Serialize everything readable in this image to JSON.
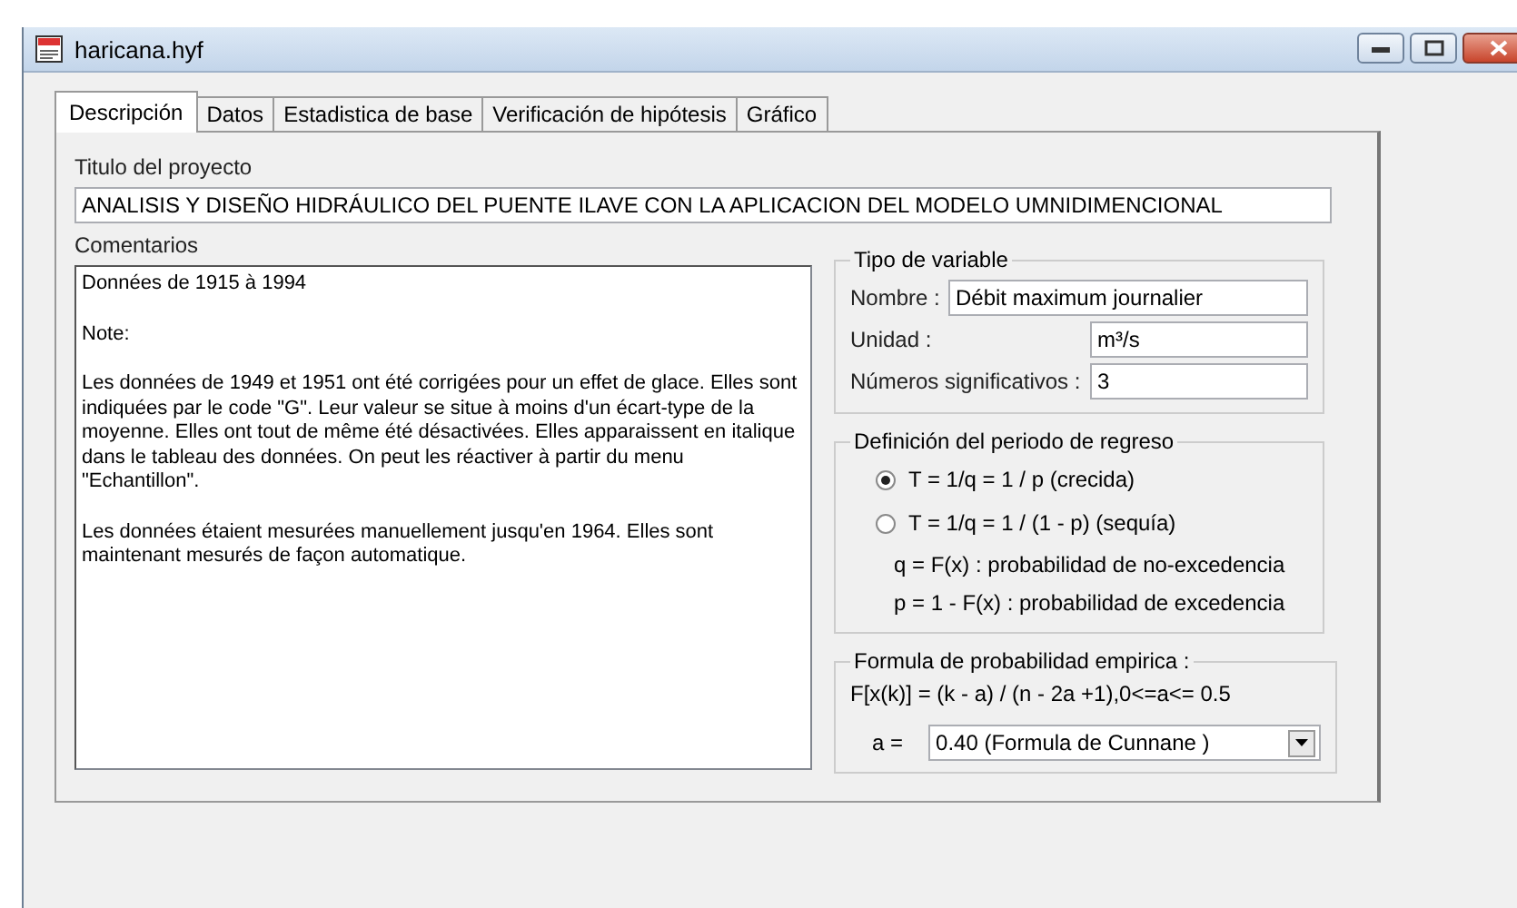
{
  "window": {
    "title": "haricana.hyf"
  },
  "tabs": [
    {
      "label": "Descripción",
      "selected": true
    },
    {
      "label": "Datos",
      "selected": false
    },
    {
      "label": "Estadistica de base",
      "selected": false
    },
    {
      "label": "Verificación de hipótesis",
      "selected": false
    },
    {
      "label": "Gráfico",
      "selected": false
    }
  ],
  "project_title": {
    "label": "Titulo del proyecto",
    "value": "ANALISIS Y DISEÑO HIDRÁULICO DEL PUENTE ILAVE CON LA APLICACION DEL MODELO UMNIDIMENCIONAL"
  },
  "comments": {
    "label": "Comentarios",
    "paragraphs": [
      "Données de 1915 à 1994",
      "Note:",
      "Les données de 1949 et 1951 ont été corrigées pour un effet de glace. Elles sont indiquées par le code \"G\". Leur valeur se situe à moins d'un écart-type de la moyenne. Elles ont tout de même été désactivées. Elles apparaissent en italique dans le tableau des données. On peut les réactiver à partir du menu \"Echantillon\".",
      "Les données étaient mesurées manuellement jusqu'en 1964. Elles sont maintenant mesurés de façon automatique."
    ]
  },
  "variable_type": {
    "legend": "Tipo de variable",
    "fields": [
      {
        "label": "Nombre :",
        "value": "Débit maximum journalier"
      },
      {
        "label": "Unidad :",
        "value": "m³/s"
      },
      {
        "label": "Números significativos :",
        "value": "3"
      }
    ]
  },
  "return_period": {
    "legend": "Definición del periodo de regreso",
    "options": [
      {
        "label": "T = 1/q = 1 / p (crecida)",
        "selected": true
      },
      {
        "label": "T = 1/q = 1 / (1 - p) (sequía)",
        "selected": false
      }
    ],
    "notes": [
      "q = F(x) : probabilidad de no-excedencia",
      "p = 1 - F(x) : probabilidad de excedencia"
    ]
  },
  "empirical_formula": {
    "legend": "Formula de probabilidad empirica :",
    "formula": "F[x(k)] = (k - a) / (n - 2a +1),0<=a<= 0.5",
    "select_label": "a =",
    "select_value": "0.40 (Formula de Cunnane )"
  }
}
